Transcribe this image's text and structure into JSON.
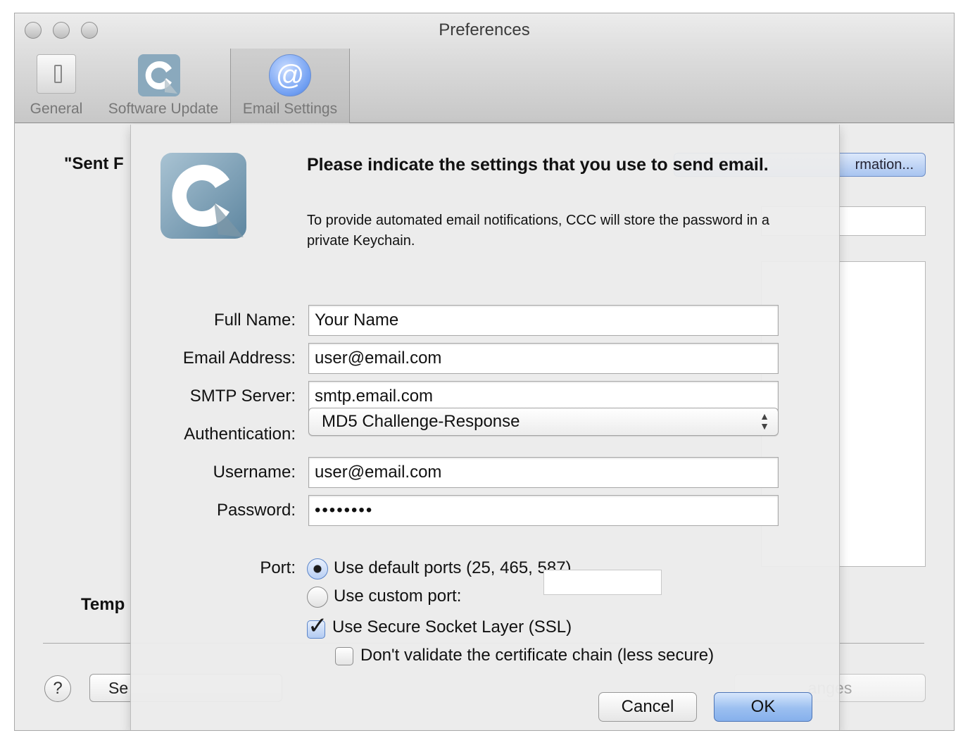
{
  "window": {
    "title": "Preferences"
  },
  "toolbar": {
    "items": [
      {
        "label": "General",
        "icon": "switch-icon"
      },
      {
        "label": "Software Update",
        "icon": "ccc-icon"
      },
      {
        "label": "Email Settings",
        "icon": "at-sign-icon",
        "active": true
      }
    ]
  },
  "background": {
    "sent_from_label": "\"Sent F",
    "account_button": "rmation...",
    "template_label": "Temp",
    "send_test_button": "Se",
    "save_button": "anges",
    "help_button": "?"
  },
  "sheet": {
    "heading": "Please indicate the settings that you use to send email.",
    "subtitle": "To provide automated email notifications, CCC will store the password in a private Keychain.",
    "fields": {
      "full_name": {
        "label": "Full Name:",
        "value": "Your Name"
      },
      "email_address": {
        "label": "Email Address:",
        "value": "user@email.com"
      },
      "smtp_server": {
        "label": "SMTP Server:",
        "value": "smtp.email.com"
      },
      "authentication": {
        "label": "Authentication:",
        "value": "MD5 Challenge-Response"
      },
      "username": {
        "label": "Username:",
        "value": "user@email.com"
      },
      "password": {
        "label": "Password:",
        "value": "••••••••"
      }
    },
    "port": {
      "label": "Port:",
      "default_option": "Use default ports (25, 465, 587)",
      "custom_option": "Use custom port:",
      "custom_value": ""
    },
    "ssl": {
      "use_ssl_label": "Use Secure Socket Layer (SSL)",
      "use_ssl_checked": true,
      "no_validate_label": "Don't validate the certificate chain (less secure)",
      "no_validate_checked": false
    },
    "buttons": {
      "cancel": "Cancel",
      "ok": "OK"
    }
  },
  "colors": {
    "accent": "#86b0ec",
    "window_bg": "#ececec"
  }
}
